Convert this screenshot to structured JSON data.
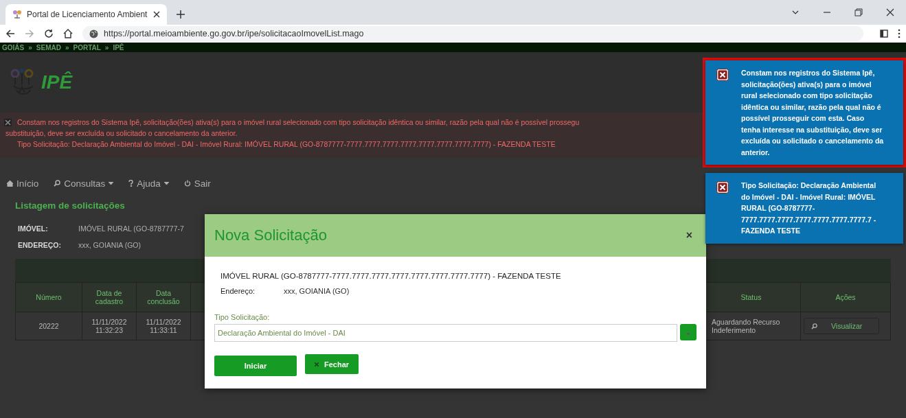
{
  "browser": {
    "tab_title": "Portal de Licenciamento Ambient",
    "url": "https://portal.meioambiente.go.gov.br/ipe/solicitacaoImovelList.mago"
  },
  "breadcrumb": {
    "separator": "»",
    "items": [
      "GOIÁS",
      "SEMAD",
      "PORTAL",
      "IPÊ"
    ]
  },
  "logo": {
    "text": "IPÊ"
  },
  "error_banner": {
    "lines": [
      "Constam nos registros do Sistema Ipê, solicitação(ões) ativa(s) para o imóvel rural selecionado com tipo solicitação idêntica ou similar, razão pela qual não é possível prossegu",
      "substituição, deve ser excluída ou solicitado o cancelamento da anterior.",
      "Tipo Solicitação: Declaração Ambiental do Imóvel - DAI - Imóvel Rural: IMÓVEL RURAL (GO-8787777-7777.7777.7777.7777.7777.7777.7777.7777) - FAZENDA TESTE"
    ]
  },
  "nav": [
    {
      "kind": "home",
      "label": "Início",
      "dropdown": false
    },
    {
      "kind": "search",
      "label": "Consultas",
      "dropdown": true
    },
    {
      "kind": "help",
      "label": "Ajuda",
      "dropdown": true
    },
    {
      "kind": "power",
      "label": "Sair",
      "dropdown": false
    }
  ],
  "page_title": "Listagem de solicitações",
  "info": [
    {
      "label": "IMÓVEL:",
      "value": "IMÓVEL RURAL (GO-8787777-7"
    },
    {
      "label": "ENDEREÇO:",
      "value": "xxx, GOIANIA (GO)"
    }
  ],
  "table": {
    "columns": [
      "Número",
      "Data de cadastro",
      "Data conclusão",
      "Status",
      "Ações"
    ],
    "rows": [
      {
        "numero": "20222",
        "cadastro": "11/11/2022 11:32:23",
        "conclusao": "11/11/2022 11:33:11",
        "status": "Aguardando Recurso Indeferimento",
        "action": "Visualizar"
      }
    ]
  },
  "modal": {
    "title": "Nova Solicitação",
    "close": "×",
    "property": "IMÓVEL RURAL (GO-8787777-7777.7777.7777.7777.7777.7777.7777.7777) - FAZENDA TESTE",
    "address_label": "Endereço:",
    "address_value": "xxx, GOIANIA (GO)",
    "type_label": "Tipo Solicitação:",
    "type_value": "Declaração Ambiental do Imóvel - DAI",
    "buttons": [
      {
        "kind": "primary",
        "label": "Iniciar"
      },
      {
        "kind": "close",
        "label": "Fechar"
      }
    ]
  },
  "notifications": [
    {
      "highlighted": true,
      "text": "Constam nos registros do Sistema Ipê, solicitação(ões) ativa(s) para o imóvel rural selecionado com tipo solicitação idêntica ou similar, razão pela qual não é possível prosseguir com esta. Caso tenha interesse na substituição, deve ser excluída ou solicitado o cancelamento da anterior."
    },
    {
      "highlighted": false,
      "text": "Tipo Solicitação: Declaração Ambiental do Imóvel - DAI - Imóvel Rural: IMÓVEL RURAL (GO-8787777-7777.7777.7777.7777.7777.7777.7777.7 - FAZENDA TESTE"
    }
  ]
}
